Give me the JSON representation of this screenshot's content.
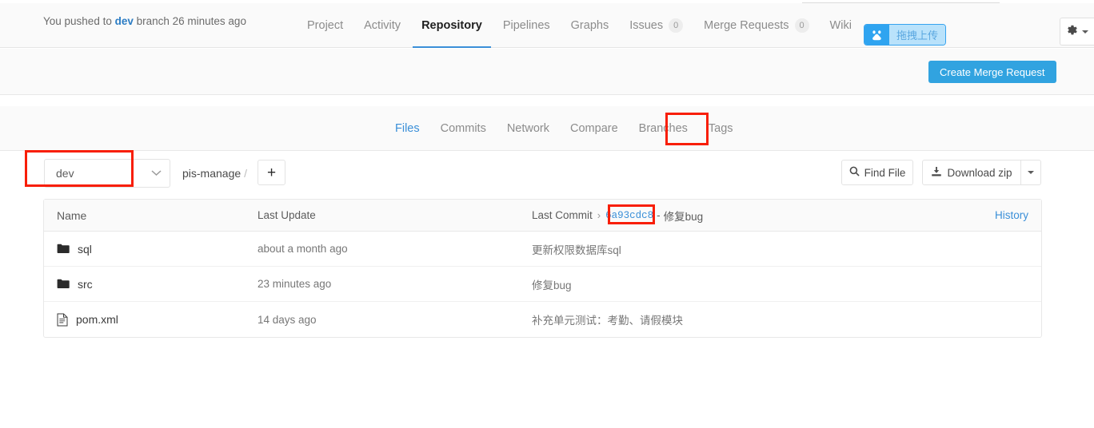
{
  "navbar": {
    "tabs": [
      {
        "label": "Project",
        "active": false,
        "badge": null
      },
      {
        "label": "Activity",
        "active": false,
        "badge": null
      },
      {
        "label": "Repository",
        "active": true,
        "badge": null
      },
      {
        "label": "Pipelines",
        "active": false,
        "badge": null
      },
      {
        "label": "Graphs",
        "active": false,
        "badge": null
      },
      {
        "label": "Issues",
        "active": false,
        "badge": "0"
      },
      {
        "label": "Merge Requests",
        "active": false,
        "badge": "0"
      },
      {
        "label": "Wiki",
        "active": false,
        "badge": null
      }
    ],
    "upload_widget": {
      "icon": "baidu-netdisk-icon",
      "label": "拖拽上传"
    },
    "settings": {
      "icon": "gear-icon",
      "caret": "chevron-down-icon"
    }
  },
  "push_bar": {
    "prefix": "You pushed to ",
    "branch": "dev",
    "suffix": " branch 26 minutes ago",
    "create_mr_label": "Create Merge Request"
  },
  "subnav": {
    "tabs": [
      {
        "label": "Files",
        "active": true
      },
      {
        "label": "Commits",
        "active": false
      },
      {
        "label": "Network",
        "active": false
      },
      {
        "label": "Compare",
        "active": false
      },
      {
        "label": "Branches",
        "active": false
      },
      {
        "label": "Tags",
        "active": false
      }
    ]
  },
  "toolbar": {
    "branch_value": "dev",
    "branch_caret": "chevron-down-icon",
    "breadcrumb_project": "pis-manage",
    "breadcrumb_sep": "/",
    "add_label": "+",
    "find_file_label": "Find File",
    "download_zip_label": "Download zip"
  },
  "table": {
    "headers": {
      "name": "Name",
      "last_update": "Last Update",
      "last_commit_label": "Last Commit",
      "last_commit_chevron": "›",
      "last_commit_hash": "6a93cdc8",
      "last_commit_dash": "-",
      "last_commit_message": "修复bug",
      "history": "History"
    },
    "rows": [
      {
        "icon": "folder-icon",
        "name": "sql",
        "last_update": "about a month ago",
        "commit": "更新权限数据库sql"
      },
      {
        "icon": "folder-icon",
        "name": "src",
        "last_update": "23 minutes ago",
        "commit": "修复bug"
      },
      {
        "icon": "file-icon",
        "name": "pom.xml",
        "last_update": "14 days ago",
        "commit": "补充单元测试：考勤、请假模块"
      }
    ]
  },
  "annotations": {
    "color": "#f81e06",
    "boxes": [
      {
        "name": "tags-highlight"
      },
      {
        "name": "branch-selector-highlight"
      },
      {
        "name": "commit-hash-highlight"
      }
    ]
  }
}
